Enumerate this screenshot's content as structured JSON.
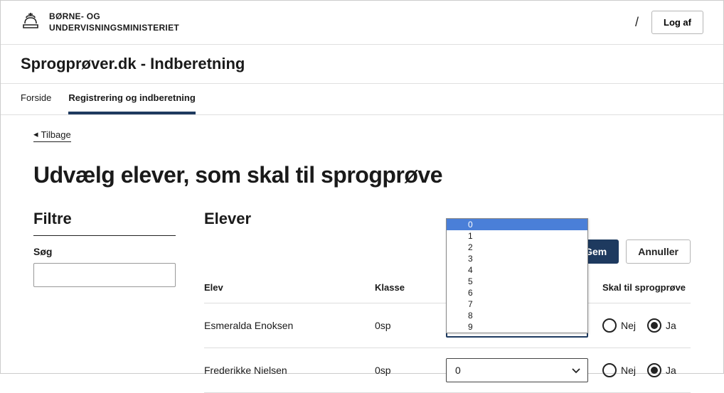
{
  "topbar": {
    "ministry_line1": "BØRNE- OG",
    "ministry_line2": "UNDERVISNINGSMINISTERIET",
    "separator": "/",
    "logout_label": "Log af"
  },
  "titlebar": {
    "title": "Sprogprøver.dk - Indberetning"
  },
  "tabs": {
    "items": [
      {
        "label": "Forside",
        "active": false
      },
      {
        "label": "Registrering og indberetning",
        "active": true
      }
    ]
  },
  "back": {
    "label": "Tilbage"
  },
  "heading": "Udvælg elever, som skal til sprogprøve",
  "filters": {
    "title": "Filtre",
    "search_label": "Søg"
  },
  "students": {
    "title": "Elever",
    "save_label": "Gem",
    "cancel_label": "Annuller",
    "columns": {
      "name": "Elev",
      "class": "Klasse",
      "attempts": "",
      "must_attend": "Skal til sprogprøve"
    },
    "rows": [
      {
        "name": "Esmeralda Enoksen",
        "class": "0sp",
        "attempts_value": "0",
        "selected_radio": "ja"
      },
      {
        "name": "Frederikke Nielsen",
        "class": "0sp",
        "attempts_value": "0",
        "selected_radio": "ja"
      }
    ],
    "radio_nej": "Nej",
    "radio_ja": "Ja"
  },
  "dropdown": {
    "options": [
      "0",
      "1",
      "2",
      "3",
      "4",
      "5",
      "6",
      "7",
      "8",
      "9"
    ],
    "highlighted": "0"
  }
}
